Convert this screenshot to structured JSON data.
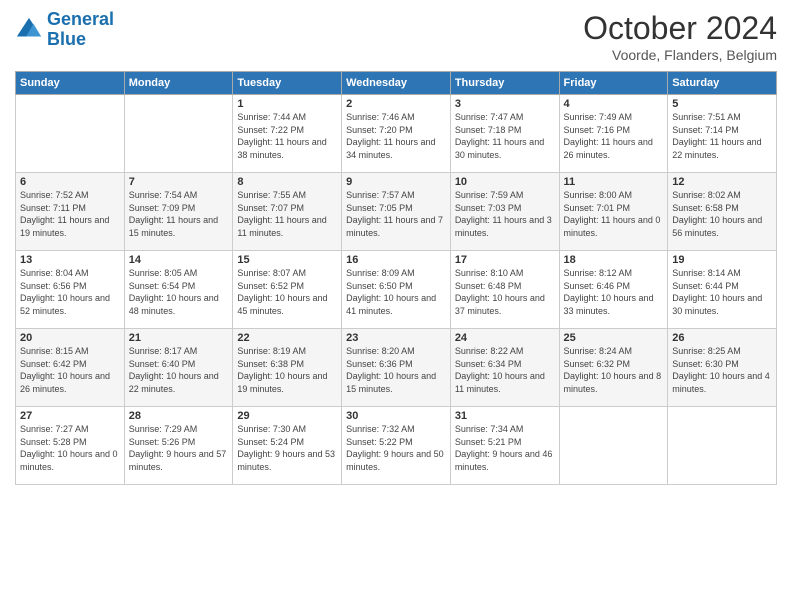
{
  "header": {
    "logo_line1": "General",
    "logo_line2": "Blue",
    "month_title": "October 2024",
    "location": "Voorde, Flanders, Belgium"
  },
  "days_of_week": [
    "Sunday",
    "Monday",
    "Tuesday",
    "Wednesday",
    "Thursday",
    "Friday",
    "Saturday"
  ],
  "weeks": [
    [
      {
        "day": "",
        "sunrise": "",
        "sunset": "",
        "daylight": ""
      },
      {
        "day": "",
        "sunrise": "",
        "sunset": "",
        "daylight": ""
      },
      {
        "day": "1",
        "sunrise": "Sunrise: 7:44 AM",
        "sunset": "Sunset: 7:22 PM",
        "daylight": "Daylight: 11 hours and 38 minutes."
      },
      {
        "day": "2",
        "sunrise": "Sunrise: 7:46 AM",
        "sunset": "Sunset: 7:20 PM",
        "daylight": "Daylight: 11 hours and 34 minutes."
      },
      {
        "day": "3",
        "sunrise": "Sunrise: 7:47 AM",
        "sunset": "Sunset: 7:18 PM",
        "daylight": "Daylight: 11 hours and 30 minutes."
      },
      {
        "day": "4",
        "sunrise": "Sunrise: 7:49 AM",
        "sunset": "Sunset: 7:16 PM",
        "daylight": "Daylight: 11 hours and 26 minutes."
      },
      {
        "day": "5",
        "sunrise": "Sunrise: 7:51 AM",
        "sunset": "Sunset: 7:14 PM",
        "daylight": "Daylight: 11 hours and 22 minutes."
      }
    ],
    [
      {
        "day": "6",
        "sunrise": "Sunrise: 7:52 AM",
        "sunset": "Sunset: 7:11 PM",
        "daylight": "Daylight: 11 hours and 19 minutes."
      },
      {
        "day": "7",
        "sunrise": "Sunrise: 7:54 AM",
        "sunset": "Sunset: 7:09 PM",
        "daylight": "Daylight: 11 hours and 15 minutes."
      },
      {
        "day": "8",
        "sunrise": "Sunrise: 7:55 AM",
        "sunset": "Sunset: 7:07 PM",
        "daylight": "Daylight: 11 hours and 11 minutes."
      },
      {
        "day": "9",
        "sunrise": "Sunrise: 7:57 AM",
        "sunset": "Sunset: 7:05 PM",
        "daylight": "Daylight: 11 hours and 7 minutes."
      },
      {
        "day": "10",
        "sunrise": "Sunrise: 7:59 AM",
        "sunset": "Sunset: 7:03 PM",
        "daylight": "Daylight: 11 hours and 3 minutes."
      },
      {
        "day": "11",
        "sunrise": "Sunrise: 8:00 AM",
        "sunset": "Sunset: 7:01 PM",
        "daylight": "Daylight: 11 hours and 0 minutes."
      },
      {
        "day": "12",
        "sunrise": "Sunrise: 8:02 AM",
        "sunset": "Sunset: 6:58 PM",
        "daylight": "Daylight: 10 hours and 56 minutes."
      }
    ],
    [
      {
        "day": "13",
        "sunrise": "Sunrise: 8:04 AM",
        "sunset": "Sunset: 6:56 PM",
        "daylight": "Daylight: 10 hours and 52 minutes."
      },
      {
        "day": "14",
        "sunrise": "Sunrise: 8:05 AM",
        "sunset": "Sunset: 6:54 PM",
        "daylight": "Daylight: 10 hours and 48 minutes."
      },
      {
        "day": "15",
        "sunrise": "Sunrise: 8:07 AM",
        "sunset": "Sunset: 6:52 PM",
        "daylight": "Daylight: 10 hours and 45 minutes."
      },
      {
        "day": "16",
        "sunrise": "Sunrise: 8:09 AM",
        "sunset": "Sunset: 6:50 PM",
        "daylight": "Daylight: 10 hours and 41 minutes."
      },
      {
        "day": "17",
        "sunrise": "Sunrise: 8:10 AM",
        "sunset": "Sunset: 6:48 PM",
        "daylight": "Daylight: 10 hours and 37 minutes."
      },
      {
        "day": "18",
        "sunrise": "Sunrise: 8:12 AM",
        "sunset": "Sunset: 6:46 PM",
        "daylight": "Daylight: 10 hours and 33 minutes."
      },
      {
        "day": "19",
        "sunrise": "Sunrise: 8:14 AM",
        "sunset": "Sunset: 6:44 PM",
        "daylight": "Daylight: 10 hours and 30 minutes."
      }
    ],
    [
      {
        "day": "20",
        "sunrise": "Sunrise: 8:15 AM",
        "sunset": "Sunset: 6:42 PM",
        "daylight": "Daylight: 10 hours and 26 minutes."
      },
      {
        "day": "21",
        "sunrise": "Sunrise: 8:17 AM",
        "sunset": "Sunset: 6:40 PM",
        "daylight": "Daylight: 10 hours and 22 minutes."
      },
      {
        "day": "22",
        "sunrise": "Sunrise: 8:19 AM",
        "sunset": "Sunset: 6:38 PM",
        "daylight": "Daylight: 10 hours and 19 minutes."
      },
      {
        "day": "23",
        "sunrise": "Sunrise: 8:20 AM",
        "sunset": "Sunset: 6:36 PM",
        "daylight": "Daylight: 10 hours and 15 minutes."
      },
      {
        "day": "24",
        "sunrise": "Sunrise: 8:22 AM",
        "sunset": "Sunset: 6:34 PM",
        "daylight": "Daylight: 10 hours and 11 minutes."
      },
      {
        "day": "25",
        "sunrise": "Sunrise: 8:24 AM",
        "sunset": "Sunset: 6:32 PM",
        "daylight": "Daylight: 10 hours and 8 minutes."
      },
      {
        "day": "26",
        "sunrise": "Sunrise: 8:25 AM",
        "sunset": "Sunset: 6:30 PM",
        "daylight": "Daylight: 10 hours and 4 minutes."
      }
    ],
    [
      {
        "day": "27",
        "sunrise": "Sunrise: 7:27 AM",
        "sunset": "Sunset: 5:28 PM",
        "daylight": "Daylight: 10 hours and 0 minutes."
      },
      {
        "day": "28",
        "sunrise": "Sunrise: 7:29 AM",
        "sunset": "Sunset: 5:26 PM",
        "daylight": "Daylight: 9 hours and 57 minutes."
      },
      {
        "day": "29",
        "sunrise": "Sunrise: 7:30 AM",
        "sunset": "Sunset: 5:24 PM",
        "daylight": "Daylight: 9 hours and 53 minutes."
      },
      {
        "day": "30",
        "sunrise": "Sunrise: 7:32 AM",
        "sunset": "Sunset: 5:22 PM",
        "daylight": "Daylight: 9 hours and 50 minutes."
      },
      {
        "day": "31",
        "sunrise": "Sunrise: 7:34 AM",
        "sunset": "Sunset: 5:21 PM",
        "daylight": "Daylight: 9 hours and 46 minutes."
      },
      {
        "day": "",
        "sunrise": "",
        "sunset": "",
        "daylight": ""
      },
      {
        "day": "",
        "sunrise": "",
        "sunset": "",
        "daylight": ""
      }
    ]
  ]
}
